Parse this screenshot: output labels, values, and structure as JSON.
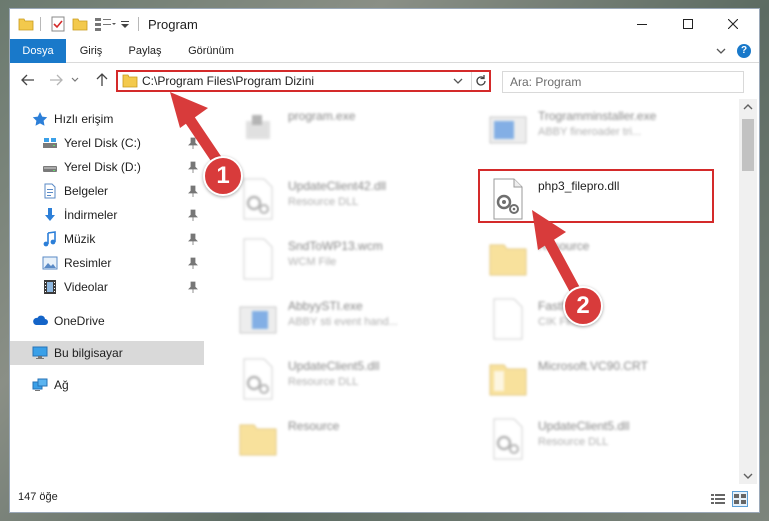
{
  "window": {
    "title": "Program",
    "minimize": "—",
    "maximize": "☐",
    "close": "✕"
  },
  "ribbon": {
    "tabs": [
      "Dosya",
      "Giriş",
      "Paylaş",
      "Görünüm"
    ],
    "help": "?"
  },
  "nav": {
    "address": "C:\\Program Files\\Program Dizini",
    "search_placeholder": "Ara: Program"
  },
  "sidebar": {
    "items": [
      {
        "label": "Hızlı erişim",
        "icon": "star-icon",
        "pinned": false
      },
      {
        "label": "Yerel Disk (C:)",
        "icon": "drive-icon",
        "pinned": true
      },
      {
        "label": "Yerel Disk (D:)",
        "icon": "drive-icon",
        "pinned": true
      },
      {
        "label": "Belgeler",
        "icon": "documents-icon",
        "pinned": true
      },
      {
        "label": "İndirmeler",
        "icon": "download-icon",
        "pinned": true
      },
      {
        "label": "Müzik",
        "icon": "music-icon",
        "pinned": true
      },
      {
        "label": "Resimler",
        "icon": "pictures-icon",
        "pinned": true
      },
      {
        "label": "Videolar",
        "icon": "video-icon",
        "pinned": true
      },
      {
        "label": "OneDrive",
        "icon": "cloud-icon",
        "pinned": false
      },
      {
        "label": "Bu bilgisayar",
        "icon": "computer-icon",
        "pinned": false
      },
      {
        "label": "Ağ",
        "icon": "network-icon",
        "pinned": false
      }
    ]
  },
  "files": [
    {
      "name": "program.exe",
      "type": "",
      "icon": "exe-icon"
    },
    {
      "name": "Trogramminstaller.exe",
      "type": "ABBY fineroader tri...",
      "icon": "app-window-icon"
    },
    {
      "name": "UpdateClient42.dll",
      "type": "Resource DLL",
      "icon": "dll-icon"
    },
    {
      "name": "php3_filepro.dll",
      "type": "",
      "icon": "dll-icon"
    },
    {
      "name": "SndToWP13.wcm",
      "type": "WCM File",
      "icon": "blank-file-icon"
    },
    {
      "name": "Resource",
      "type": "",
      "icon": "folder-icon"
    },
    {
      "name": "AbbyySTI.exe",
      "type": "ABBY sti event hand...",
      "icon": "app-window-icon"
    },
    {
      "name": "FastN...",
      "type": "CIK Fil...",
      "icon": "blank-file-icon"
    },
    {
      "name": "UpdateClient5.dll",
      "type": "Resource DLL",
      "icon": "dll-icon"
    },
    {
      "name": "Microsoft.VC90.CRT",
      "type": "",
      "icon": "folder-icon"
    },
    {
      "name": "Resource",
      "type": "",
      "icon": "folder-icon"
    },
    {
      "name": "UpdateClient5.dll",
      "type": "Resource DLL",
      "icon": "dll-icon"
    }
  ],
  "status": {
    "count": "147 öğe"
  },
  "annotations": {
    "badge1": "1",
    "badge2": "2",
    "color": "#d83b3b"
  }
}
